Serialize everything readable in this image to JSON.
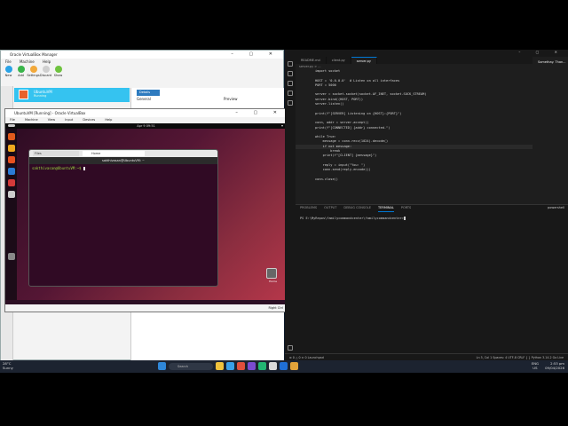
{
  "vbox_manager": {
    "title": "Oracle VirtualBox Manager",
    "menu": [
      "File",
      "Machine",
      "Help"
    ],
    "toolbar": [
      {
        "label": "New",
        "color": "#2aa3e6"
      },
      {
        "label": "Add",
        "color": "#39b54a"
      },
      {
        "label": "Settings",
        "color": "#f2a93b"
      },
      {
        "label": "Discard",
        "color": "#cfcfcf"
      },
      {
        "label": "Show",
        "color": "#6fc33f"
      }
    ],
    "vm": {
      "name": "UbuntuVM",
      "state": "Running"
    },
    "details_button": "Details",
    "general_heading": "General",
    "preview_heading": "Preview"
  },
  "vm_window": {
    "title": "UbuntuVM [Running] - Oracle VirtualBox",
    "menu": [
      "File",
      "Machine",
      "View",
      "Input",
      "Devices",
      "Help"
    ],
    "status_host_key": "Right Ctrl",
    "ubuntu": {
      "clock": "Apr 9 09:51",
      "terminal": {
        "tab1": "Files",
        "tab2": "Home",
        "title": "sakthivasan@UbuntuVM: ~",
        "prompt": "sakthivasan@UbuntuVM:~$"
      },
      "trash_label": "Home",
      "dock_colors": [
        "#e05a1c",
        "#f0a81e",
        "#e8511f",
        "#2a7bd5",
        "#d33a3a",
        "#cccccc",
        "#888888"
      ]
    }
  },
  "vscode": {
    "tabs": [
      {
        "label": "README.md",
        "active": false
      },
      {
        "label": "client.py",
        "active": false
      },
      {
        "label": "server.py",
        "active": true
      }
    ],
    "breadcrumb": "server.py > ...",
    "code": [
      "import socket",
      "",
      "HOST = '0.0.0.0'  # Listen on all interfaces",
      "PORT = 5000",
      "",
      "server = socket.socket(socket.AF_INET, socket.SOCK_STREAM)",
      "server.bind((HOST, PORT))",
      "server.listen()",
      "",
      "print(f\"[SERVER] Listening on {HOST}:{PORT}\")",
      "",
      "conn, addr = server.accept()",
      "print(f\"[CONNECTED] {addr} connected.\")",
      "",
      "while True:",
      "    message = conn.recv(1024).decode()",
      "    if not message:",
      "        break",
      "    print(f\"[CLIENT] {message}\")",
      "",
      "    reply = input(\"You: \")",
      "    conn.send(reply.encode())",
      "",
      "conn.close()"
    ],
    "right_panel_text": "Somethay. Than...",
    "panel_tabs": [
      {
        "label": "PROBLEMS",
        "active": false
      },
      {
        "label": "OUTPUT",
        "active": false
      },
      {
        "label": "DEBUG CONSOLE",
        "active": false
      },
      {
        "label": "TERMINAL",
        "active": true
      },
      {
        "label": "PORTS",
        "active": false
      }
    ],
    "panel_tool": "powershell",
    "terminal_prompt": "PS E:\\MyRepos\\familycommandcenter\\familycommandcenter>",
    "status_left": "⊗ 0 △ 0   ⊙ 0   Launchpad",
    "status_right": "Ln 5, Col 1   Spaces: 4   UTF-8   CRLF   { } Python   3.14.2   Go Live"
  },
  "taskbar": {
    "weather_temp": "28°C",
    "weather_desc": "Sunny",
    "search_placeholder": "Search",
    "lang": "ENG",
    "region": "US",
    "time": "2:53 pm",
    "date": "09/04/2026",
    "icon_colors": [
      "#2f87d8",
      "#f0c23c",
      "#3aa0e8",
      "#e14f3c",
      "#7a4bd0",
      "#22b573",
      "#d9d9d9",
      "#1f6fd6",
      "#e3a33a"
    ]
  }
}
